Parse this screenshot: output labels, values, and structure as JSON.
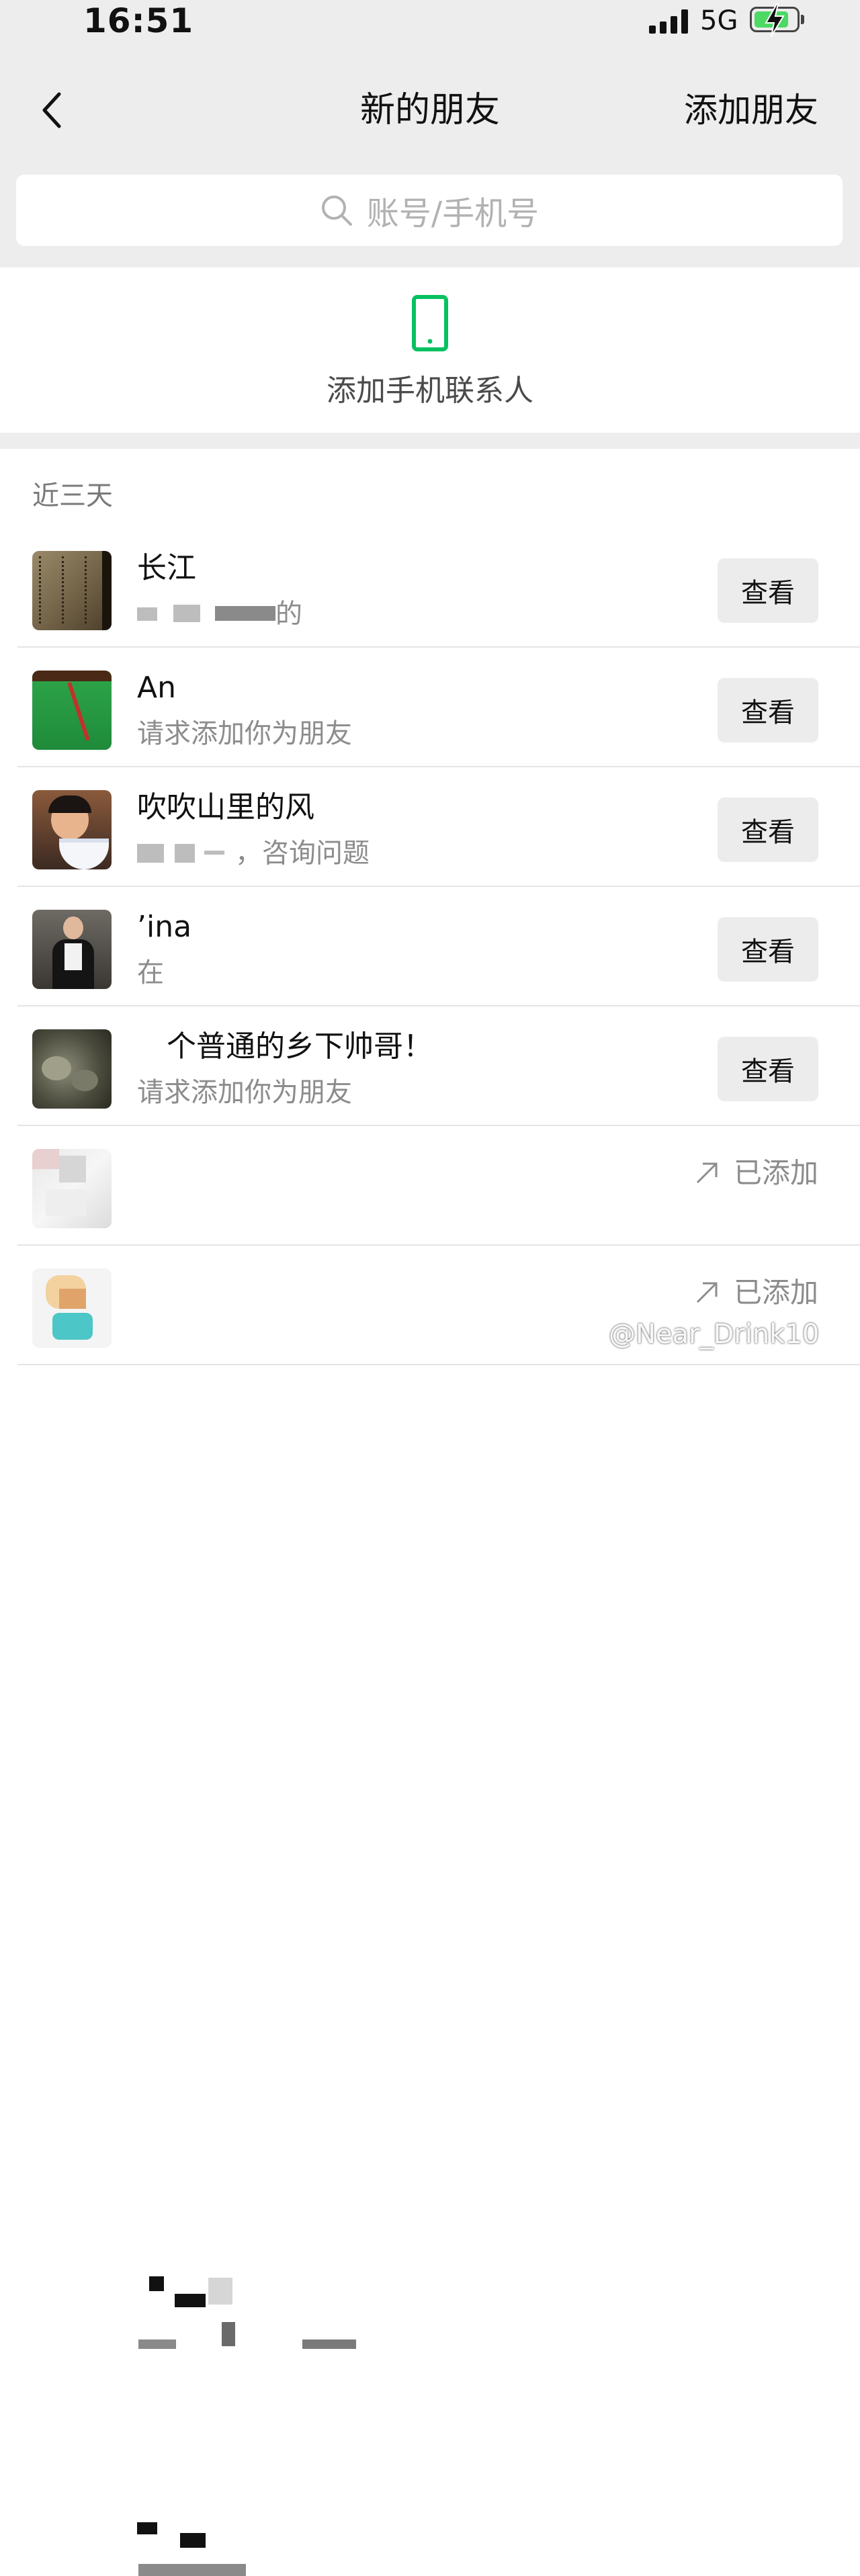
{
  "status_bar": {
    "time": "16:51",
    "network": "5G",
    "signal_icon": "signal-bars-icon",
    "battery_icon": "battery-charging-icon",
    "battery_color": "#4cd964"
  },
  "nav": {
    "back_icon": "chevron-left-icon",
    "title": "新的朋友",
    "action_label": "添加朋友"
  },
  "search": {
    "icon": "search-icon",
    "placeholder": "账号/手机号"
  },
  "add_contacts": {
    "icon": "mobile-phone-icon",
    "icon_color": "#07c160",
    "label": "添加手机联系人"
  },
  "section": {
    "title": "近三天"
  },
  "requests": [
    {
      "name": "长江",
      "subtitle": "的",
      "action": "查看",
      "avatar": "calligraphy-avatar"
    },
    {
      "name": "An",
      "subtitle": "请求添加你为朋友",
      "action": "查看",
      "avatar": "snooker-table-avatar"
    },
    {
      "name": "吹吹山里的风",
      "subtitle": "，咨询问题",
      "action": "查看",
      "avatar": "child-eating-rice-avatar"
    },
    {
      "name": "ina",
      "subtitle": "在",
      "action": "查看",
      "avatar": "man-photo-avatar"
    },
    {
      "name": "个普通的乡下帅哥！",
      "subtitle": "请求添加你为朋友",
      "action": "查看",
      "avatar": "rocks-avatar"
    },
    {
      "name": "",
      "subtitle": "",
      "action": "已添加",
      "avatar": "blurred-avatar"
    },
    {
      "name": "",
      "subtitle": "",
      "action": "已添加",
      "avatar": "blurred-cartoon-avatar"
    }
  ],
  "watermark": "@Near_Drink10"
}
